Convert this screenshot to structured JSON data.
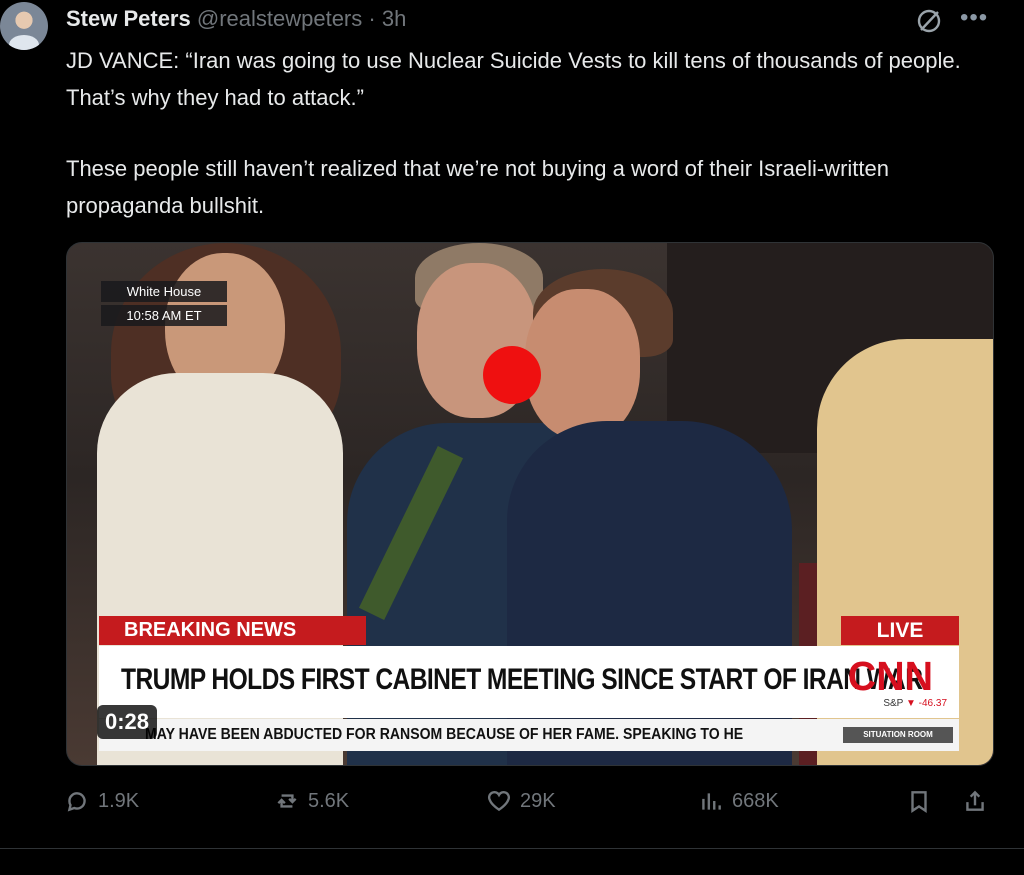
{
  "post": {
    "author_name": "Stew Peters",
    "author_handle": "@realstewpeters",
    "separator": "·",
    "time_ago": "3h",
    "text_paragraphs": [
      "JD VANCE: “Iran was going to use Nuclear Suicide Vests to kill tens of thousands of people. That’s why they had to attack.”",
      "These people still haven’t realized that we’re not buying a word of their Israeli-written propaganda bullshit."
    ]
  },
  "video": {
    "location": "White House",
    "time": "10:58 AM ET",
    "breaking": "BREAKING NEWS",
    "live": "LIVE",
    "headline": "TRUMP HOLDS FIRST CABINET MEETING SINCE START OF IRAN WAR",
    "network": "CNN",
    "market_label": "S&P",
    "market_change": "▼ -46.37",
    "ticker": "MAY HAVE BEEN ABDUCTED FOR RANSOM BECAUSE OF HER FAME. SPEAKING TO HE",
    "program": "SITUATION ROOM",
    "duration": "0:28"
  },
  "actions": {
    "replies": "1.9K",
    "reposts": "5.6K",
    "likes": "29K",
    "views": "668K"
  },
  "icons": [
    "grok-icon",
    "more-icon",
    "reply-icon",
    "repost-icon",
    "like-icon",
    "views-icon",
    "bookmark-icon",
    "share-icon"
  ]
}
